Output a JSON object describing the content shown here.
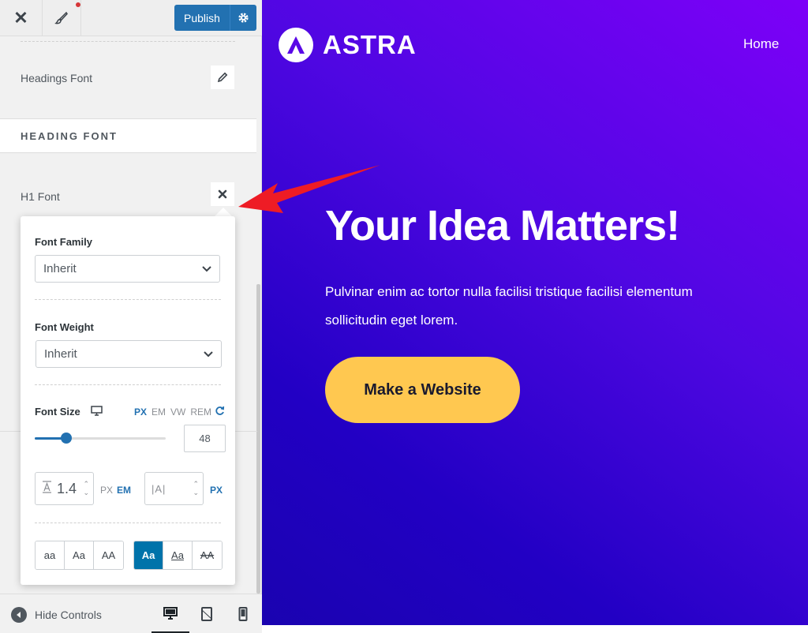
{
  "topbar": {
    "publish_label": "Publish"
  },
  "sidebar": {
    "headings_font_label": "Headings Font",
    "section_title": "HEADING FONT",
    "h1_font_label": "H1 Font"
  },
  "popover": {
    "font_family_label": "Font Family",
    "font_family_value": "Inherit",
    "font_weight_label": "Font Weight",
    "font_weight_value": "Inherit",
    "font_size_label": "Font Size",
    "units": [
      "PX",
      "EM",
      "VW",
      "REM"
    ],
    "active_unit": "PX",
    "font_size_value": "48",
    "slider_fraction": 0.24,
    "line_height_value": "1.4",
    "line_height_units": [
      "PX",
      "EM"
    ],
    "letter_spacing_icon": "|A|",
    "letter_spacing_unit": "PX",
    "text_transform": [
      "aa",
      "Aa",
      "AA"
    ],
    "text_decoration": [
      "Aa",
      "Aa",
      "AA"
    ]
  },
  "bottombar": {
    "hide_controls_label": "Hide Controls"
  },
  "preview": {
    "logo_text": "ASTRA",
    "nav_home": "Home",
    "hero_title": "Your Idea Matters!",
    "hero_text": "Pulvinar enim ac tortor nulla facilisi tristique facilisi elementum sollicitudin eget lorem.",
    "cta_label": "Make a Website"
  },
  "colors": {
    "accent": "#2271b1",
    "cta": "#ffc850",
    "gradient_start": "#7d00f8",
    "gradient_end": "#1a03b0",
    "annotation_arrow": "#ee1c25"
  }
}
